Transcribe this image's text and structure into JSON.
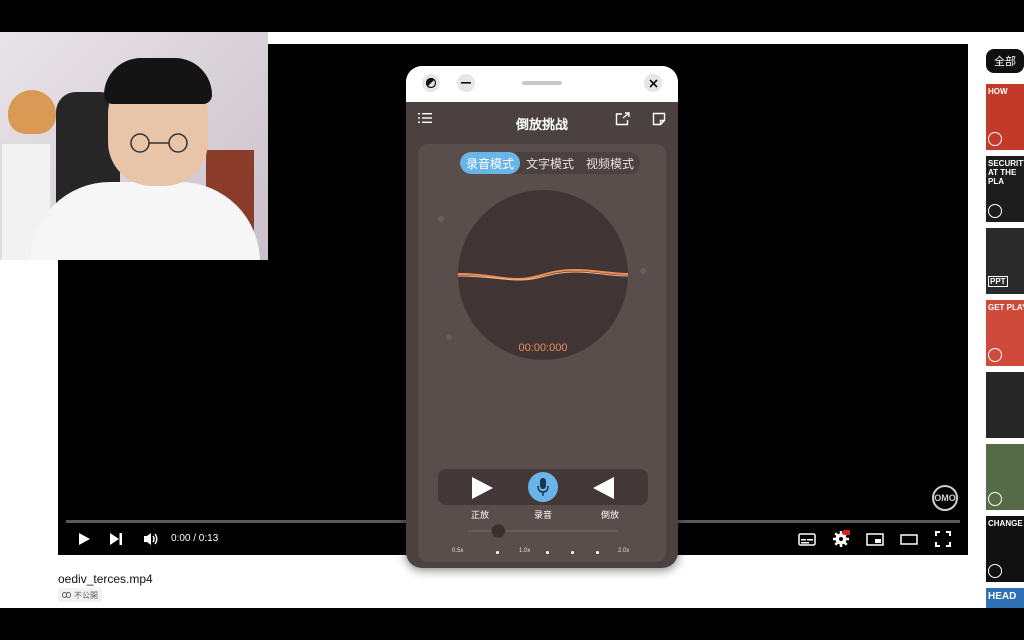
{
  "player": {
    "time_display": "0:00 / 0:13",
    "progress_fraction": 0,
    "watermark": "OMO"
  },
  "video_info": {
    "title": "oediv_terces.mp4",
    "visibility": "不公開"
  },
  "sidebar": {
    "filter_chip": "全部",
    "thumbnails": [
      {
        "text": "HOW",
        "bg": "#c43a2a"
      },
      {
        "text": "SECURITY AT THE PLA",
        "bg": "#1d1d1d"
      },
      {
        "text": "PPT",
        "bg": "#2a2a2a"
      },
      {
        "text": "GET PLAY",
        "bg": "#cf4a3a"
      },
      {
        "text": "",
        "bg": "#262626"
      },
      {
        "text": "",
        "bg": "#556b48"
      },
      {
        "text": "CHANGE LAR",
        "bg": "#111111"
      },
      {
        "text": "HEAD",
        "bg": "#2f6fb3"
      }
    ]
  },
  "app": {
    "title": "倒放挑战",
    "tabs": [
      {
        "label": "录音模式",
        "active": true
      },
      {
        "label": "文字模式",
        "active": false
      },
      {
        "label": "视频模式",
        "active": false
      }
    ],
    "timer": "00:00:000",
    "buttons": {
      "forward_label": "正放",
      "record_label": "录音",
      "reverse_label": "倒放"
    },
    "speed": {
      "min_label": "0.5x",
      "mid_label": "1.0x",
      "max_label": "2.0x",
      "value": 0.75
    },
    "colors": {
      "accent": "#6ab5e8",
      "waveform": "#ef8e55",
      "background": "#4b4140"
    }
  }
}
